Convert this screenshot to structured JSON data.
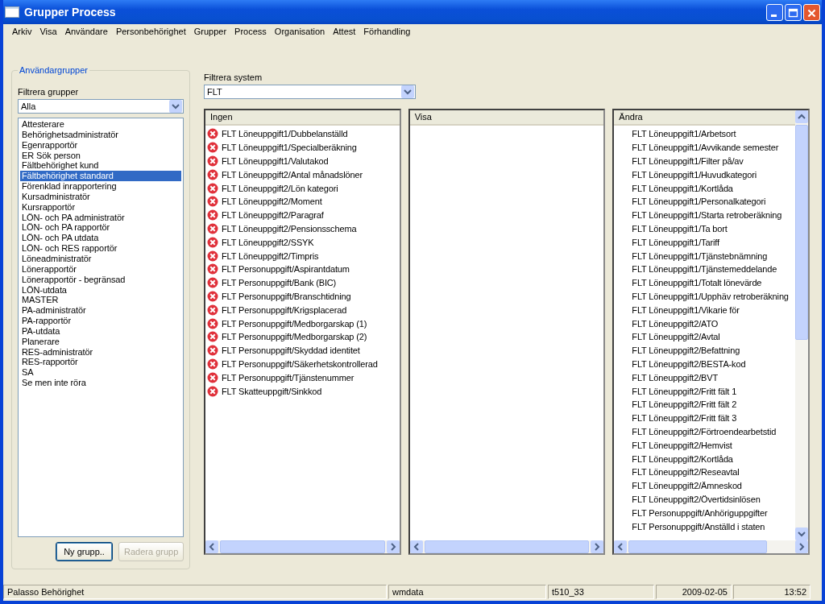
{
  "window": {
    "title": "Grupper Process"
  },
  "menu": [
    {
      "label": "Arkiv"
    },
    {
      "label": "Visa"
    },
    {
      "label": "Användare"
    },
    {
      "label": "Personbehörighet"
    },
    {
      "label": "Grupper"
    },
    {
      "label": "Process"
    },
    {
      "label": "Organisation"
    },
    {
      "label": "Attest"
    },
    {
      "label": "Förhandling"
    }
  ],
  "groups_panel": {
    "title": "Användargrupper",
    "filter_label": "Filtrera grupper",
    "filter_value": "Alla",
    "groups": [
      {
        "label": "Attesterare",
        "selected": false
      },
      {
        "label": "Behörighetsadministratör",
        "selected": false
      },
      {
        "label": "Egenrapportör",
        "selected": false
      },
      {
        "label": "ER Sök person",
        "selected": false
      },
      {
        "label": "Fältbehörighet kund",
        "selected": false
      },
      {
        "label": "Fältbehörighet standard",
        "selected": true
      },
      {
        "label": "Förenklad inrapportering",
        "selected": false
      },
      {
        "label": "Kursadministratör",
        "selected": false
      },
      {
        "label": "Kursrapportör",
        "selected": false
      },
      {
        "label": "LÖN- och PA administratör",
        "selected": false
      },
      {
        "label": "LÖN- och PA rapportör",
        "selected": false
      },
      {
        "label": "LÖN- och PA utdata",
        "selected": false
      },
      {
        "label": "LÖN- och RES rapportör",
        "selected": false
      },
      {
        "label": "Löneadministratör",
        "selected": false
      },
      {
        "label": "Lönerapportör",
        "selected": false
      },
      {
        "label": "Lönerapportör - begränsad",
        "selected": false
      },
      {
        "label": "LÖN-utdata",
        "selected": false
      },
      {
        "label": "MASTER",
        "selected": false
      },
      {
        "label": "PA-administratör",
        "selected": false
      },
      {
        "label": "PA-rapportör",
        "selected": false
      },
      {
        "label": "PA-utdata",
        "selected": false
      },
      {
        "label": "Planerare",
        "selected": false
      },
      {
        "label": "RES-administratör",
        "selected": false
      },
      {
        "label": "RES-rapportör",
        "selected": false
      },
      {
        "label": "SA",
        "selected": false
      },
      {
        "label": "Se men inte röra",
        "selected": false
      }
    ],
    "buttons": [
      {
        "label": "Ny grupp..",
        "disabled": false
      },
      {
        "label": "Radera grupp",
        "disabled": true
      }
    ]
  },
  "system_filter": {
    "label": "Filtrera system",
    "value": "FLT"
  },
  "columns": [
    {
      "header": "Ingen",
      "vertical_scroll": false,
      "items": [
        {
          "label": "FLT Löneuppgift1/Dubbelanställd",
          "kind": "denied"
        },
        {
          "label": "FLT Löneuppgift1/Specialberäkning",
          "kind": "denied"
        },
        {
          "label": "FLT Löneuppgift1/Valutakod",
          "kind": "denied"
        },
        {
          "label": "FLT Löneuppgift2/Antal månadslöner",
          "kind": "denied"
        },
        {
          "label": "FLT Löneuppgift2/Lön kategori",
          "kind": "denied"
        },
        {
          "label": "FLT Löneuppgift2/Moment",
          "kind": "denied"
        },
        {
          "label": "FLT Löneuppgift2/Paragraf",
          "kind": "denied"
        },
        {
          "label": "FLT Löneuppgift2/Pensionsschema",
          "kind": "denied"
        },
        {
          "label": "FLT Löneuppgift2/SSYK",
          "kind": "denied"
        },
        {
          "label": "FLT Löneuppgift2/Timpris",
          "kind": "denied"
        },
        {
          "label": "FLT Personuppgift/Aspirantdatum",
          "kind": "denied"
        },
        {
          "label": "FLT Personuppgift/Bank (BIC)",
          "kind": "denied"
        },
        {
          "label": "FLT Personuppgift/Branschtidning",
          "kind": "denied"
        },
        {
          "label": "FLT Personuppgift/Krigsplacerad",
          "kind": "denied"
        },
        {
          "label": "FLT Personuppgift/Medborgarskap (1)",
          "kind": "denied"
        },
        {
          "label": "FLT Personuppgift/Medborgarskap (2)",
          "kind": "denied"
        },
        {
          "label": "FLT Personuppgift/Skyddad identitet",
          "kind": "denied"
        },
        {
          "label": "FLT Personuppgift/Säkerhetskontrollerad",
          "kind": "denied"
        },
        {
          "label": "FLT Personuppgift/Tjänstenummer",
          "kind": "denied"
        },
        {
          "label": "FLT Skatteuppgift/Sinkkod",
          "kind": "denied"
        }
      ]
    },
    {
      "header": "Visa",
      "vertical_scroll": false
    },
    {
      "header": "Ändra",
      "vertical_scroll": true,
      "items": [
        {
          "label": "FLT Löneuppgift1/Arbetsort",
          "kind": "plain"
        },
        {
          "label": "FLT Löneuppgift1/Avvikande semester",
          "kind": "plain"
        },
        {
          "label": "FLT Löneuppgift1/Filter på/av",
          "kind": "plain"
        },
        {
          "label": "FLT Löneuppgift1/Huvudkategori",
          "kind": "plain"
        },
        {
          "label": "FLT Löneuppgift1/Kortlåda",
          "kind": "plain"
        },
        {
          "label": "FLT Löneuppgift1/Personalkategori",
          "kind": "plain"
        },
        {
          "label": "FLT Löneuppgift1/Starta retroberäkning",
          "kind": "plain"
        },
        {
          "label": "FLT Löneuppgift1/Ta bort",
          "kind": "plain"
        },
        {
          "label": "FLT Löneuppgift1/Tariff",
          "kind": "plain"
        },
        {
          "label": "FLT Löneuppgift1/Tjänstebnämning",
          "kind": "plain"
        },
        {
          "label": "FLT Löneuppgift1/Tjänstemeddelande",
          "kind": "plain"
        },
        {
          "label": "FLT Löneuppgift1/Totalt lönevärde",
          "kind": "plain"
        },
        {
          "label": "FLT Löneuppgift1/Upphäv retroberäkning",
          "kind": "plain"
        },
        {
          "label": "FLT Löneuppgift1/Vikarie för",
          "kind": "plain"
        },
        {
          "label": "FLT Löneuppgift2/ATO",
          "kind": "plain"
        },
        {
          "label": "FLT Löneuppgift2/Avtal",
          "kind": "plain"
        },
        {
          "label": "FLT Löneuppgift2/Befattning",
          "kind": "plain"
        },
        {
          "label": "FLT Löneuppgift2/BESTA-kod",
          "kind": "plain"
        },
        {
          "label": "FLT Löneuppgift2/BVT",
          "kind": "plain"
        },
        {
          "label": "FLT Löneuppgift2/Fritt fält 1",
          "kind": "plain"
        },
        {
          "label": "FLT Löneuppgift2/Fritt fält 2",
          "kind": "plain"
        },
        {
          "label": "FLT Löneuppgift2/Fritt fält 3",
          "kind": "plain"
        },
        {
          "label": "FLT Löneuppgift2/Förtroendearbetstid",
          "kind": "plain"
        },
        {
          "label": "FLT Löneuppgift2/Hemvist",
          "kind": "plain"
        },
        {
          "label": "FLT Löneuppgift2/Kortlåda",
          "kind": "plain"
        },
        {
          "label": "FLT Löneuppgift2/Reseavtal",
          "kind": "plain"
        },
        {
          "label": "FLT Löneuppgift2/Ämneskod",
          "kind": "plain"
        },
        {
          "label": "FLT Löneuppgift2/Övertidsinlösen",
          "kind": "plain"
        },
        {
          "label": "FLT Personuppgift/Anhöriguppgifter",
          "kind": "plain"
        },
        {
          "label": "FLT Personuppgift/Anställd i staten",
          "kind": "plain"
        }
      ]
    }
  ],
  "status_bar": [
    "Palasso Behörighet",
    "wmdata",
    "t510_33",
    "2009-02-05",
    "13:52"
  ]
}
